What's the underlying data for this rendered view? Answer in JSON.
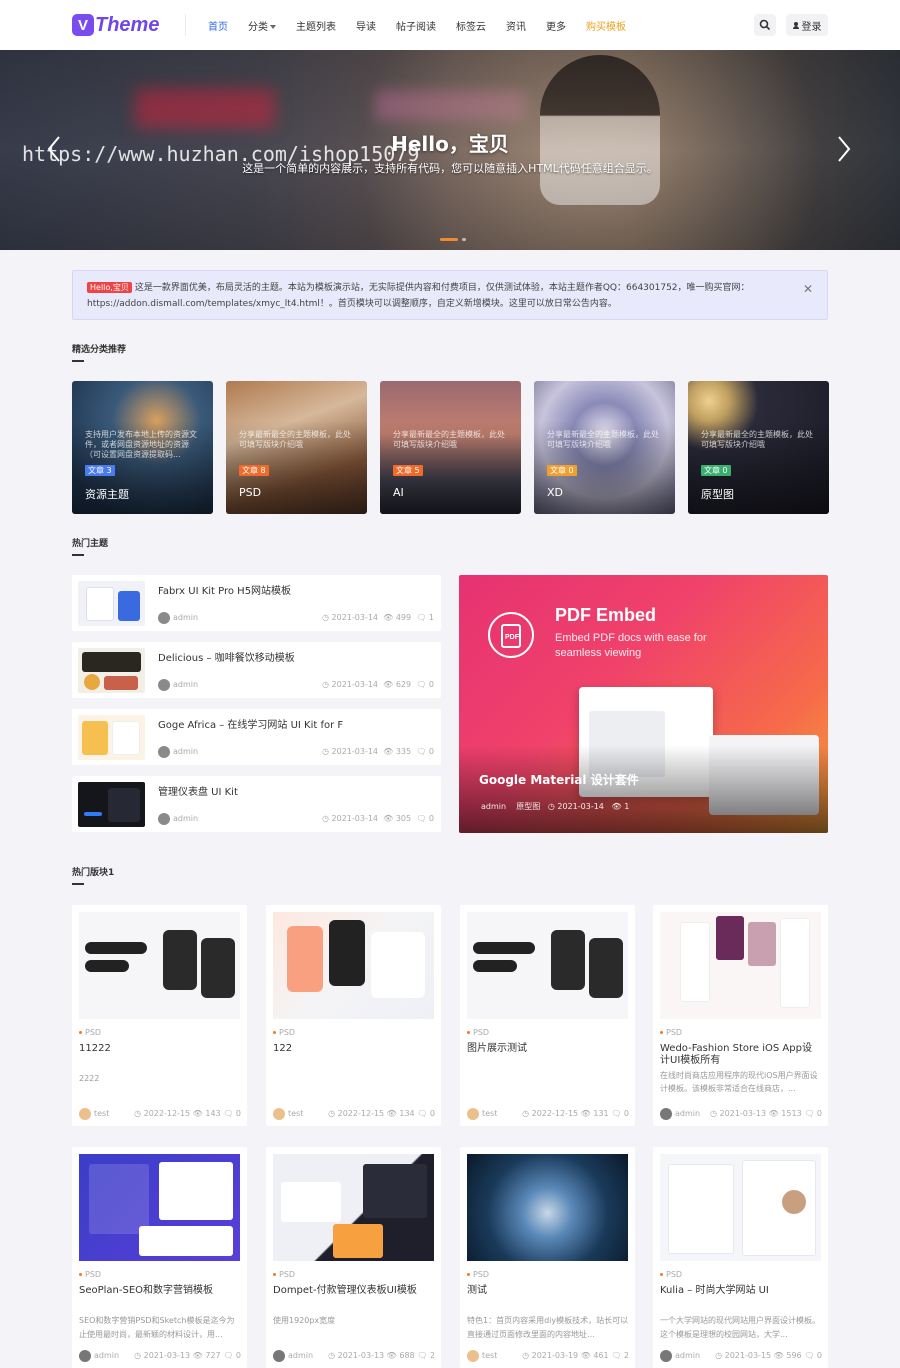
{
  "header": {
    "logo_text": "Theme",
    "nav": [
      "首页",
      "分类",
      "主题列表",
      "导读",
      "帖子阅读",
      "标签云",
      "资讯",
      "更多",
      "购买模板"
    ],
    "login": "登录"
  },
  "banner": {
    "title": "Hello，宝贝",
    "subtitle": "这是一个简单的内容展示，支持所有代码，您可以随意插入HTML代码任意组合显示。",
    "watermark": "https://www.huzhan.com/ishop15079"
  },
  "notice": {
    "tag": "Hello,宝贝",
    "text": "这是一款界面优美，布局灵活的主题。本站为模板演示站，无实际提供内容和付费项目，仅供测试体验，本站主题作者QQ：664301752，唯一购买官网：https://addon.dismall.com/templates/xmyc_lt4.html！。首页模块可以调整顺序，自定义新增模块。这里可以放日常公告内容。",
    "close": "✕"
  },
  "section_titles": {
    "cats": "精选分类推荐",
    "hot": "热门主题",
    "board": "热门版块1"
  },
  "categories": [
    {
      "desc": "支持用户发布本地上传的资源文件，或者网盘资源地址的资源（可设置网盘资源提取码...",
      "badge": "文章 3",
      "name": "资源主题",
      "badge_color": "#4a7cf0"
    },
    {
      "desc": "分享最新最全的主题模板，此处可填写版块介绍哦",
      "badge": "文章 8",
      "name": "PSD",
      "badge_color": "#f06a2a"
    },
    {
      "desc": "分享最新最全的主题模板，此处可填写版块介绍哦",
      "badge": "文章 5",
      "name": "AI",
      "badge_color": "#f06a2a"
    },
    {
      "desc": "分享最新最全的主题模板，此处可填写版块介绍哦",
      "badge": "文章 0",
      "name": "XD",
      "badge_color": "#f0a030"
    },
    {
      "desc": "分享最新最全的主题模板，此处可填写版块介绍哦",
      "badge": "文章 0",
      "name": "原型图",
      "badge_color": "#3ab070"
    }
  ],
  "hot_list": [
    {
      "title": "Fabrx UI Kit Pro H5网站模板",
      "author": "admin",
      "date": "2021-03-14",
      "views": "499",
      "replies": "1"
    },
    {
      "title": "Delicious – 咖啡餐饮移动模板",
      "author": "admin",
      "date": "2021-03-14",
      "views": "629",
      "replies": "0"
    },
    {
      "title": "Goge Africa – 在线学习网站 UI Kit for F",
      "author": "admin",
      "date": "2021-03-14",
      "views": "335",
      "replies": "0"
    },
    {
      "title": "管理仪表盘 UI Kit",
      "author": "admin",
      "date": "2021-03-14",
      "views": "305",
      "replies": "0"
    }
  ],
  "featured": {
    "headline": "PDF Embed",
    "tagline": "Embed PDF docs with ease for seamless viewing",
    "title": "Google Material 设计套件",
    "author": "admin",
    "category": "原型图",
    "date": "2021-03-14",
    "views": "1"
  },
  "cards": [
    {
      "type": "PSD",
      "title": "11222",
      "desc": "2222",
      "author": "test",
      "date": "2022-12-15",
      "views": "143",
      "replies": "0"
    },
    {
      "type": "PSD",
      "title": "122",
      "desc": "",
      "author": "test",
      "date": "2022-12-15",
      "views": "134",
      "replies": "0"
    },
    {
      "type": "PSD",
      "title": "图片展示测试",
      "desc": "",
      "author": "test",
      "date": "2022-12-15",
      "views": "131",
      "replies": "0"
    },
    {
      "type": "PSD",
      "title": "Wedo-Fashion Store iOS App设计UI模板所有",
      "desc": "在线时尚商店应用程序的现代iOS用户界面设计模板。该模板非常适合在线商店，...",
      "author": "admin",
      "date": "2021-03-13",
      "views": "1513",
      "replies": "0"
    },
    {
      "type": "PSD",
      "title": "SeoPlan-SEO和数字营销模板",
      "desc": "SEO和数字营销PSD和Sketch模板是迄今为止使用最时尚，最新颖的材料设计，用...",
      "author": "admin",
      "date": "2021-03-13",
      "views": "727",
      "replies": "0"
    },
    {
      "type": "PSD",
      "title": "Dompet-付款管理仪表板UI模板",
      "desc": "使用1920px宽度",
      "author": "admin",
      "date": "2021-03-13",
      "views": "688",
      "replies": "2"
    },
    {
      "type": "PSD",
      "title": "测试",
      "desc": "特色1：首页内容采用diy模板技术，站长可以直接通过页面修改里面的内容地址...",
      "author": "test",
      "date": "2021-03-19",
      "views": "461",
      "replies": "2"
    },
    {
      "type": "PSD",
      "title": "Kulia – 时尚大学网站 UI",
      "desc": "一个大学网站的现代网站用户界面设计模板。这个模板是理想的校园网站，大学...",
      "author": "admin",
      "date": "2021-03-15",
      "views": "596",
      "replies": "0"
    }
  ]
}
